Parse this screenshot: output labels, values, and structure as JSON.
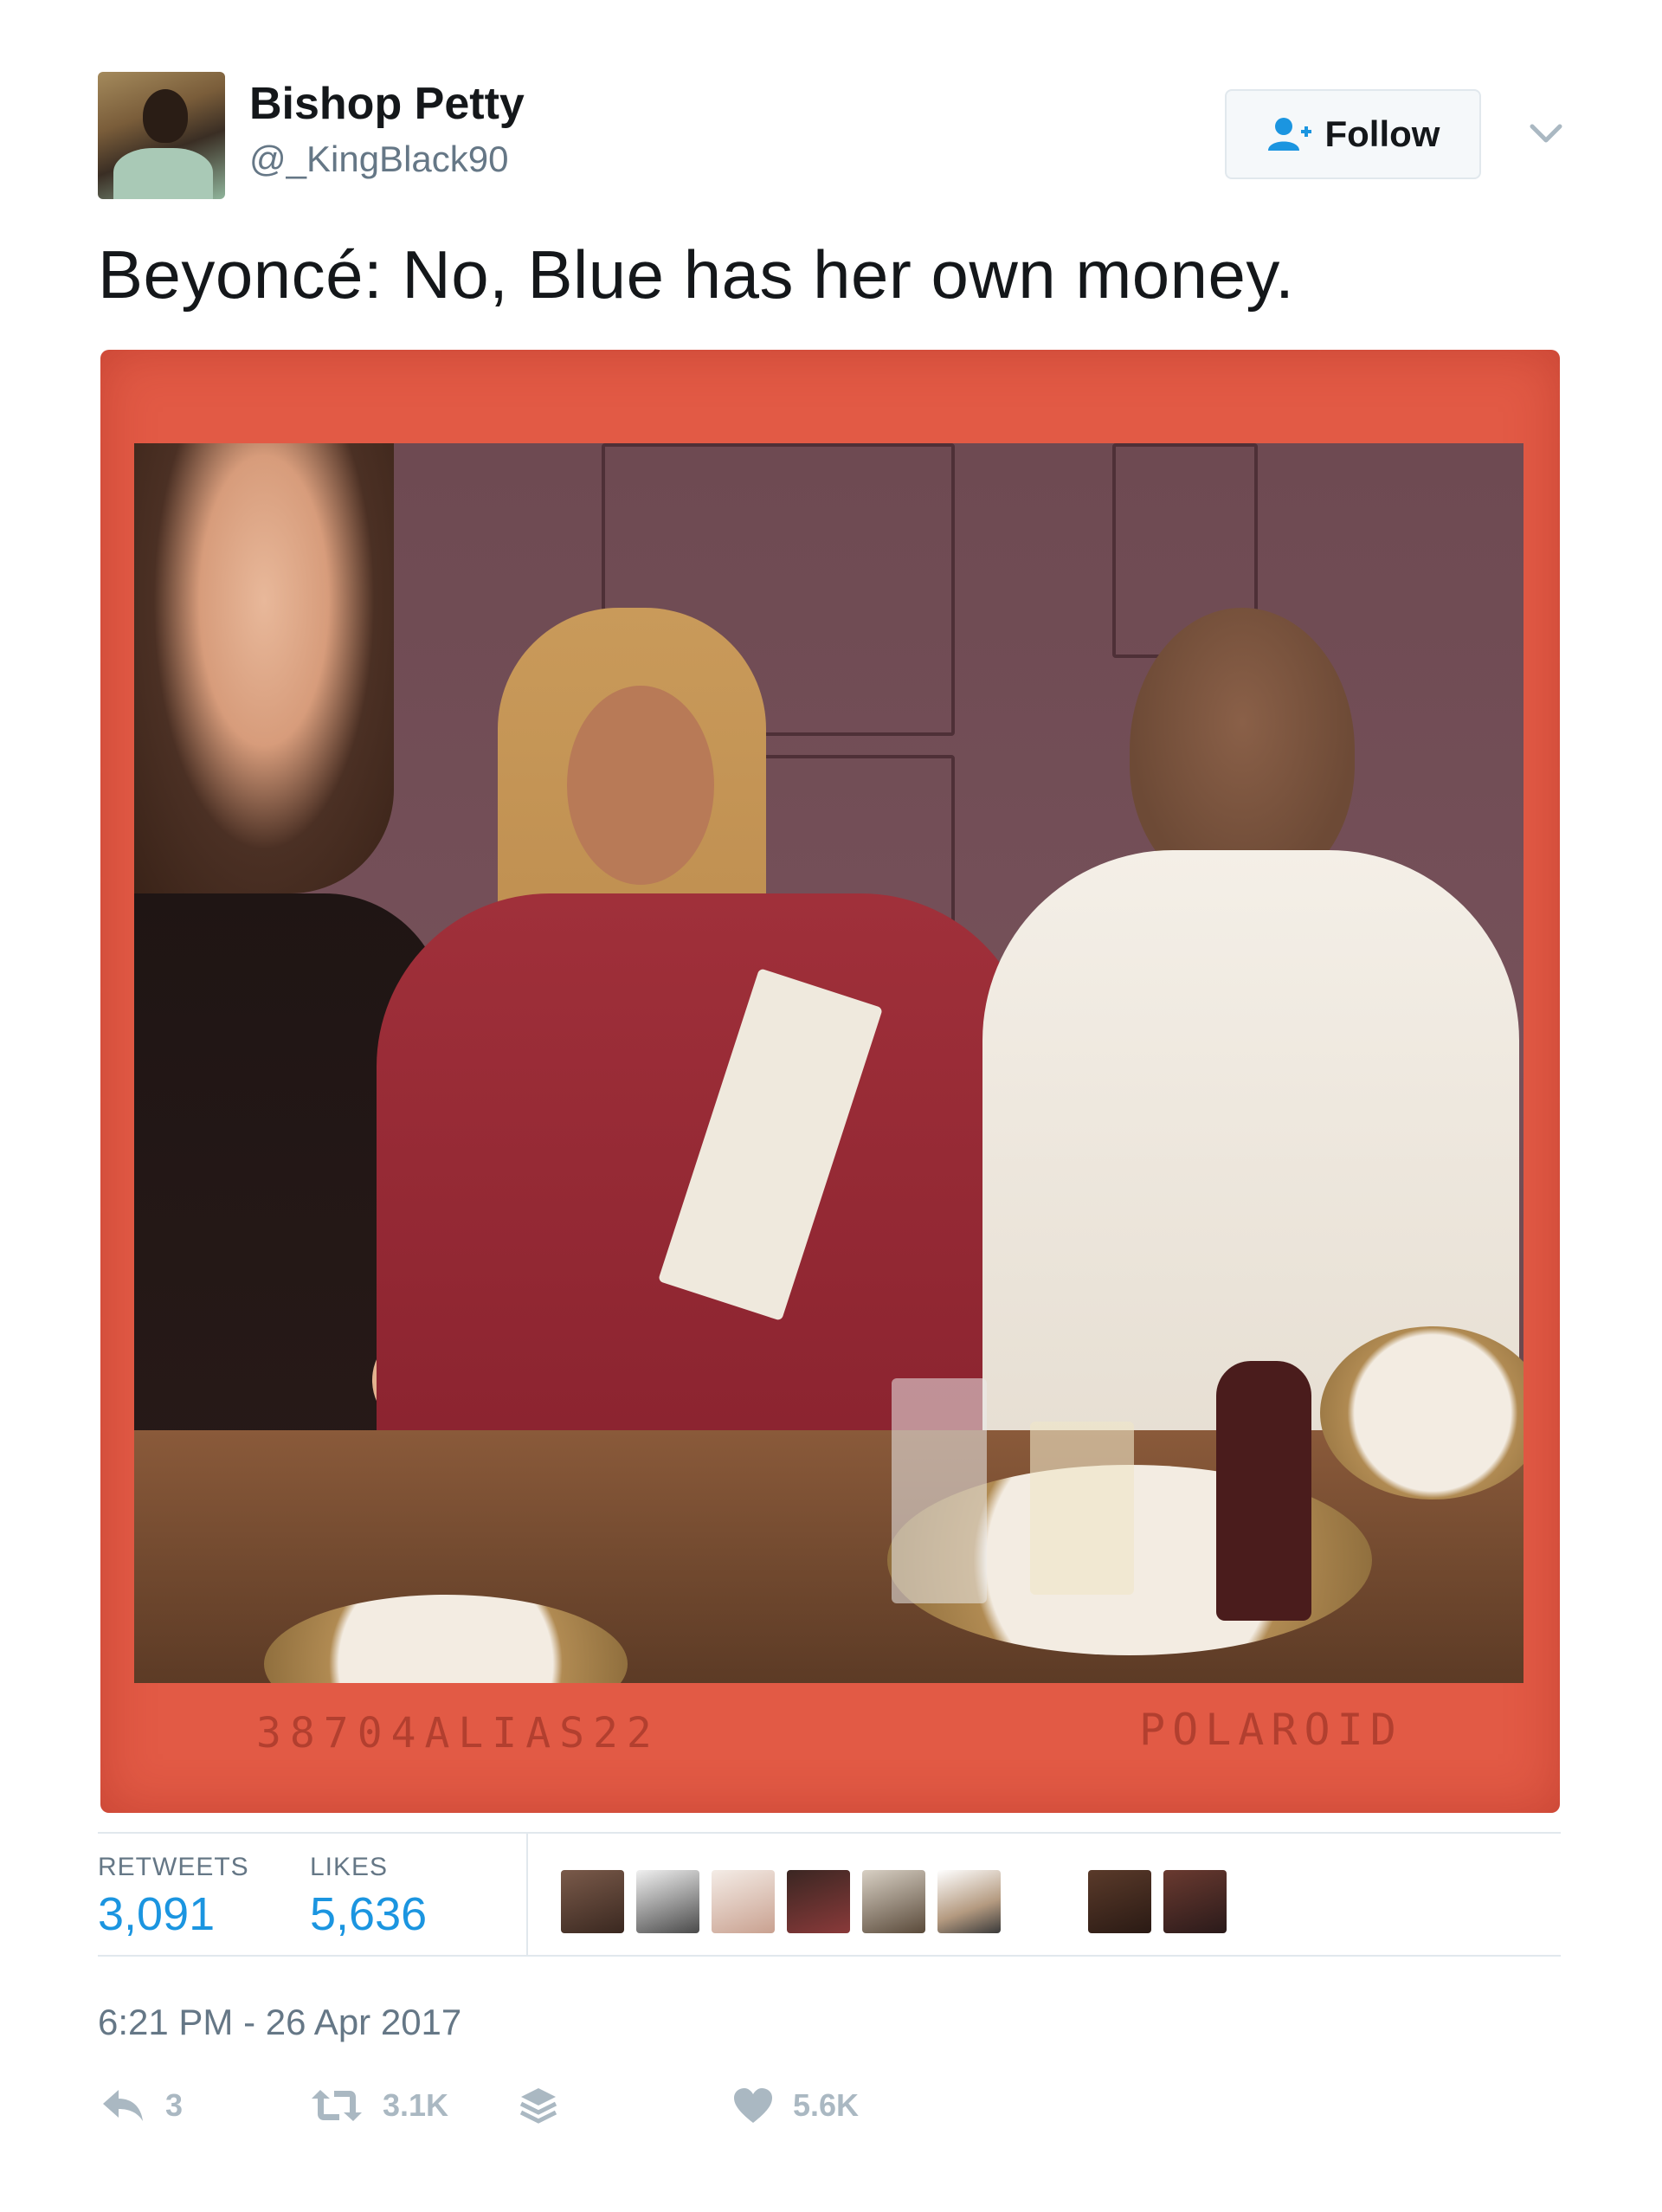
{
  "author": {
    "display_name": "Bishop Petty",
    "handle": "@_KingBlack90"
  },
  "follow_button": {
    "label": "Follow"
  },
  "tweet": {
    "text": "Beyoncé: No, Blue has her own money."
  },
  "photo": {
    "stamp_left": "38704ALIAS22",
    "stamp_right": "POLAROID"
  },
  "stats": {
    "retweets_label": "RETWEETS",
    "retweets_value": "3,091",
    "likes_label": "LIKES",
    "likes_value": "5,636"
  },
  "timestamp": "6:21 PM - 26 Apr 2017",
  "actions": {
    "reply_count": "3",
    "retweet_count": "3.1K",
    "like_count": "5.6K"
  },
  "colors": {
    "link_blue": "#1b95e0",
    "muted_gray": "#657786",
    "icon_gray": "#aab8c2",
    "photo_frame_red": "#e25a45"
  },
  "icons": [
    "follow-person-icon",
    "chevron-down-icon",
    "reply-icon",
    "retweet-icon",
    "stack-icon",
    "heart-icon"
  ]
}
